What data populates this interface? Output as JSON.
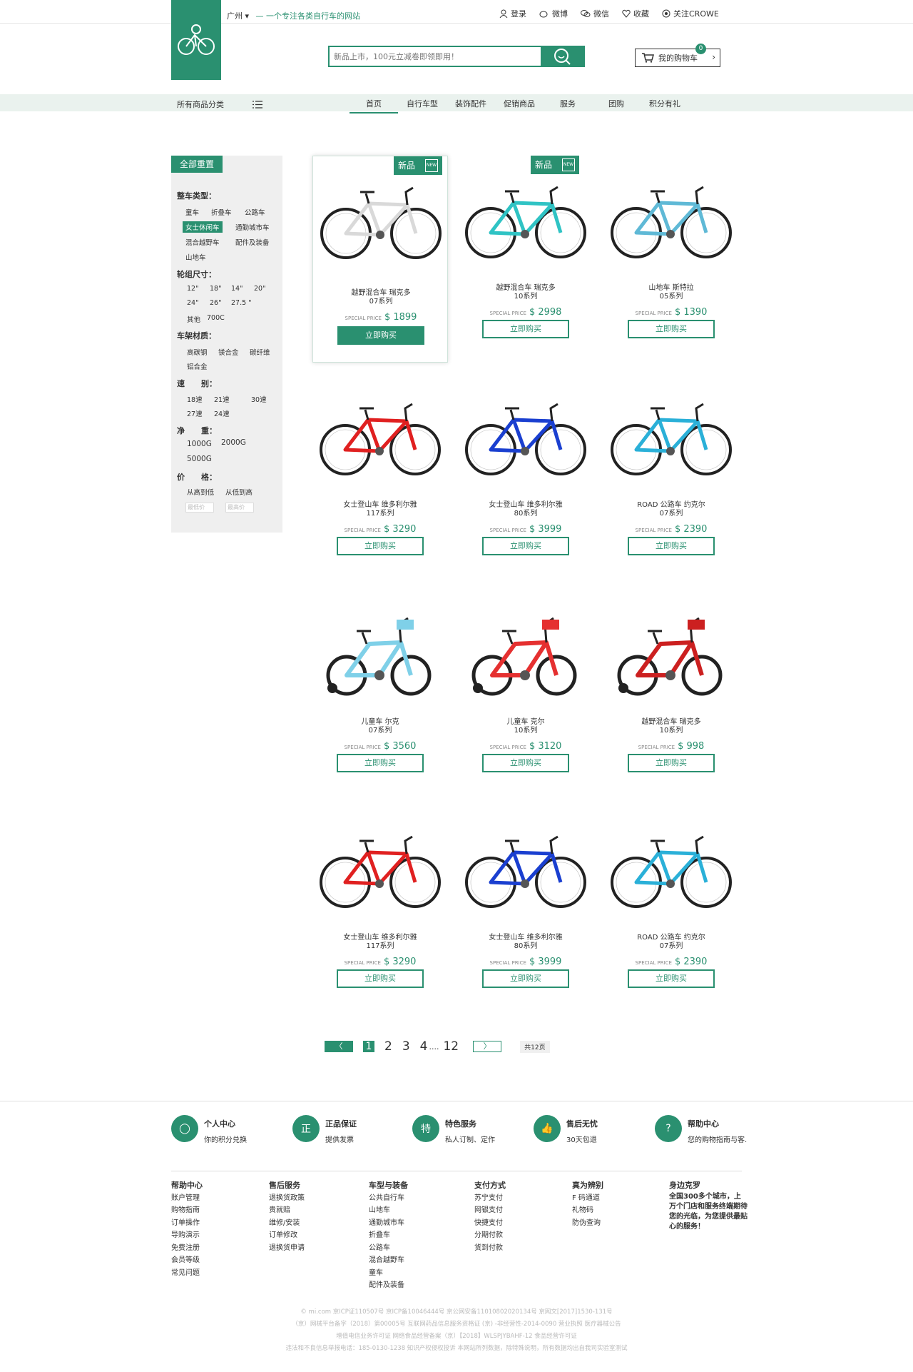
{
  "header": {
    "city": "广州",
    "slogan": "一个专注各类自行车的网站",
    "links": {
      "login": "登录",
      "weibo": "微博",
      "wechat": "微信",
      "favorite": "收藏",
      "follow": "关注CROWE"
    },
    "search_placeholder": "新品上市，100元立减卷即领即用！",
    "cart_label": "我的购物车",
    "cart_count": "0"
  },
  "nav": {
    "all_categories": "所有商品分类",
    "items": [
      "首页",
      "自行车型",
      "装饰配件",
      "促销商品",
      "服务",
      "团购",
      "积分有礼"
    ]
  },
  "sidebar": {
    "reset": "全部重置",
    "groups": {
      "type": "整车类型：",
      "wheel": "轮组尺寸：",
      "frame": "车架材质：",
      "speed": "速      别：",
      "weight": "净      重：",
      "price": "价      格："
    },
    "type_options": [
      "童车",
      "折叠车",
      "公路车",
      "女士休闲车",
      "通勤城市车",
      "混合越野车",
      "配件及装备",
      "山地车"
    ],
    "wheel_options": [
      "12\"",
      "18\"",
      "14\"",
      "20\"",
      "24\"",
      "26\"",
      "27.5 \"",
      "其他",
      "700C"
    ],
    "frame_options": [
      "高碳钢",
      "镁合金",
      "碳纤维",
      "铝合金"
    ],
    "speed_options": [
      "18速",
      "21速",
      "30速",
      "27速",
      "24速"
    ],
    "weight_options": [
      "1000G",
      "2000G",
      "5000G"
    ],
    "price_options": [
      "从高到低",
      "从低到高"
    ],
    "price_min_placeholder": "最低价",
    "price_max_placeholder": "最高价"
  },
  "products": [
    {
      "name": "越野混合车 瑞克多",
      "series": "07系列",
      "special": "SPECIAL PRICE",
      "price": "$ 1899",
      "buy": "立即购买",
      "is_new": true,
      "color": "#d9d9d9"
    },
    {
      "name": "越野混合车 瑞克多",
      "series": "10系列",
      "special": "SPECIAL PRICE",
      "price": "$ 2998",
      "buy": "立即购买",
      "is_new": true,
      "color": "#2fc3c4"
    },
    {
      "name": "山地车 斯特拉",
      "series": "05系列",
      "special": "SPECIAL PRICE",
      "price": "$ 1390",
      "buy": "立即购买",
      "is_new": false,
      "color": "#5fb9d6"
    },
    {
      "name": "女士登山车 维多利尔雅",
      "series": "117系列",
      "special": "SPECIAL PRICE",
      "price": "$ 3290",
      "buy": "立即购买",
      "is_new": false,
      "color": "#e02020"
    },
    {
      "name": "女士登山车 维多利尔雅",
      "series": "80系列",
      "special": "SPECIAL PRICE",
      "price": "$ 3999",
      "buy": "立即购买",
      "is_new": false,
      "color": "#1a3fd0"
    },
    {
      "name": "ROAD 公路车 约克尔",
      "series": "07系列",
      "special": "SPECIAL PRICE",
      "price": "$ 2390",
      "buy": "立即购买",
      "is_new": false,
      "color": "#2ab0d8"
    },
    {
      "name": "儿童车 尔克",
      "series": "07系列",
      "special": "SPECIAL PRICE",
      "price": "$ 3560",
      "buy": "立即购买",
      "is_new": false,
      "color": "#7fd0e8"
    },
    {
      "name": "儿童车 克尔",
      "series": "10系列",
      "special": "SPECIAL PRICE",
      "price": "$ 3120",
      "buy": "立即购买",
      "is_new": false,
      "color": "#e53030"
    },
    {
      "name": "越野混合车 瑞克多",
      "series": "10系列",
      "special": "SPECIAL PRICE",
      "price": "$ 998",
      "buy": "立即购买",
      "is_new": false,
      "color": "#cc2020"
    },
    {
      "name": "女士登山车 维多利尔雅",
      "series": "117系列",
      "special": "SPECIAL PRICE",
      "price": "$ 3290",
      "buy": "立即购买",
      "is_new": false,
      "color": "#e02020"
    },
    {
      "name": "女士登山车 维多利尔雅",
      "series": "80系列",
      "special": "SPECIAL PRICE",
      "price": "$ 3999",
      "buy": "立即购买",
      "is_new": false,
      "color": "#1a3fd0"
    },
    {
      "name": "ROAD 公路车 约克尔",
      "series": "07系列",
      "special": "SPECIAL PRICE",
      "price": "$ 2390",
      "buy": "立即购买",
      "is_new": false,
      "color": "#2ab0d8"
    }
  ],
  "new_tag": "新品",
  "new_badge": "NEW",
  "pager": {
    "pages": [
      "1",
      "2",
      "3",
      "4",
      "....",
      "12"
    ],
    "total": "共12页",
    "current": "1"
  },
  "services": [
    {
      "title": "个人中心",
      "desc": "你的积分兑换",
      "icon": "person-icon"
    },
    {
      "title": "正品保证",
      "desc": "提供发票",
      "icon": "genuine-icon"
    },
    {
      "title": "特色服务",
      "desc": "私人订制、定作",
      "icon": "special-icon"
    },
    {
      "title": "售后无忧",
      "desc": "30天包退",
      "icon": "thumb-up-icon"
    },
    {
      "title": "帮助中心",
      "desc": "您的购物指南与客.",
      "icon": "help-icon"
    }
  ],
  "footer_cols": [
    {
      "head": "帮助中心",
      "items": [
        "账户管理",
        "购物指南",
        "订单操作",
        "导购演示",
        "免费注册",
        "会员等级",
        "常见问题"
      ]
    },
    {
      "head": "售后服务",
      "items": [
        "退换货政策",
        "贵就赔",
        "维修/安装",
        "订单修改",
        "退换货申请"
      ]
    },
    {
      "head": "车型与装备",
      "items": [
        "公共自行车",
        "山地车",
        "通勤城市车",
        "折叠车",
        "公路车",
        "混合越野车",
        "童车",
        "配件及装备"
      ]
    },
    {
      "head": "支付方式",
      "items": [
        "苏宁支付",
        "网银支付",
        "快捷支付",
        "分期付款",
        "货到付款"
      ]
    },
    {
      "head": "真为辨别",
      "items": [
        "F 码通道",
        "礼物码",
        "防伪查询"
      ]
    }
  ],
  "footer_brand": {
    "head": "身边克罗",
    "body": "全国300多个城市，上万个门店和服务终端期待您的光临，为您提供最贴心的服务！"
  },
  "copyright": [
    "© mi.com  京ICP证110507号  京ICP备10046444号  京公网安备11010802020134号  京网文[2017]1530-131号",
    "（京）网械平台备字（2018）第00005号  互联网药品信息服务资格证 (京) -非经营性-2014-0090  营业执照  医疗器械公告",
    "增值电信业务许可证  网络食品经营备案（京）【2018】WLSPJYBAHF-12  食品经营许可证",
    "违法和不良信息举报电话：185-0130-1238  知识产权侵权投诉  本网站所列数据，除特殊说明，所有数据均出自我司实验室测试"
  ]
}
